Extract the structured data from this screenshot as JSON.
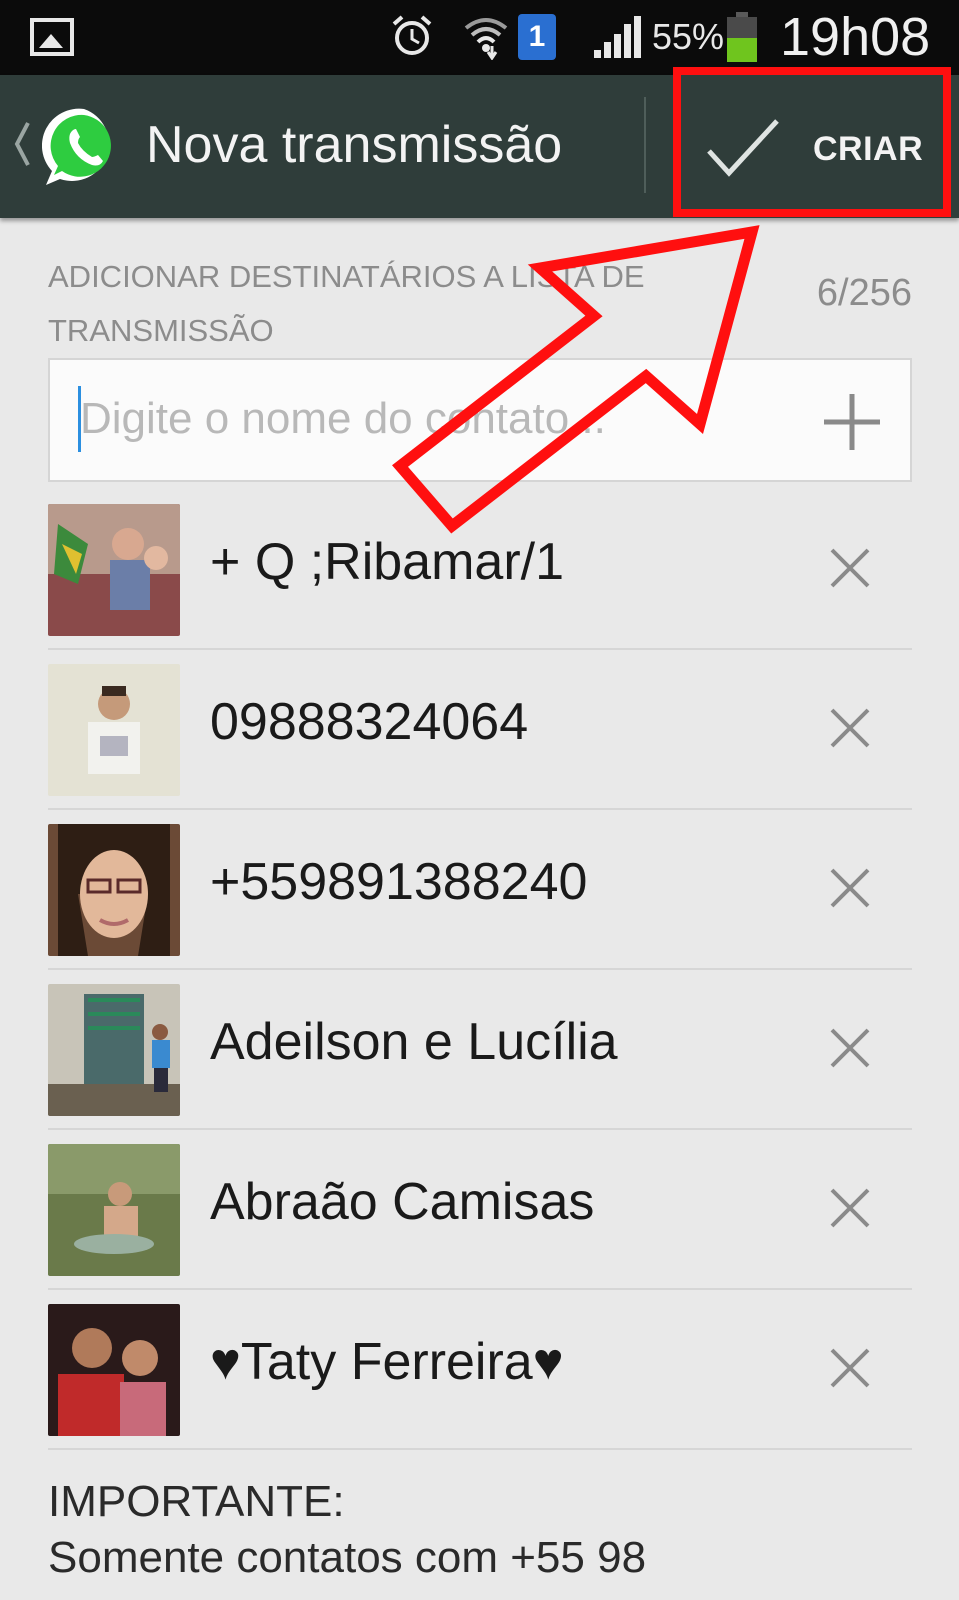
{
  "status_bar": {
    "battery_percent": "55%",
    "time": "19h08",
    "notification_badge": "1",
    "icons": [
      "gallery-icon",
      "alarm-icon",
      "wifi-icon",
      "signal-icon",
      "battery-icon"
    ]
  },
  "action_bar": {
    "title": "Nova transmissão",
    "create_label": "CRIAR",
    "icons": [
      "back-chevron-icon",
      "whatsapp-logo-icon",
      "check-icon"
    ]
  },
  "recipients": {
    "section_label": "ADICIONAR DESTINATÁRIOS A LISTA DE TRANSMISSÃO",
    "count": "6/256"
  },
  "search": {
    "placeholder": "Digite o nome do contato..."
  },
  "contacts": [
    {
      "name": "+ Q ;Ribamar/1"
    },
    {
      "name": "09888324064"
    },
    {
      "name": "+559891388240"
    },
    {
      "name": "Adeilson e Lucília"
    },
    {
      "name": "Abraão Camisas"
    },
    {
      "name": "♥Taty Ferreira♥"
    }
  ],
  "note": {
    "heading": "IMPORTANTE:",
    "text": "Somente contatos com +55 98"
  },
  "colors": {
    "action_bar": "#2f3d3a",
    "highlight": "#ff0f0f",
    "whatsapp_green": "#2ecc40",
    "background": "#e9e9e9"
  }
}
